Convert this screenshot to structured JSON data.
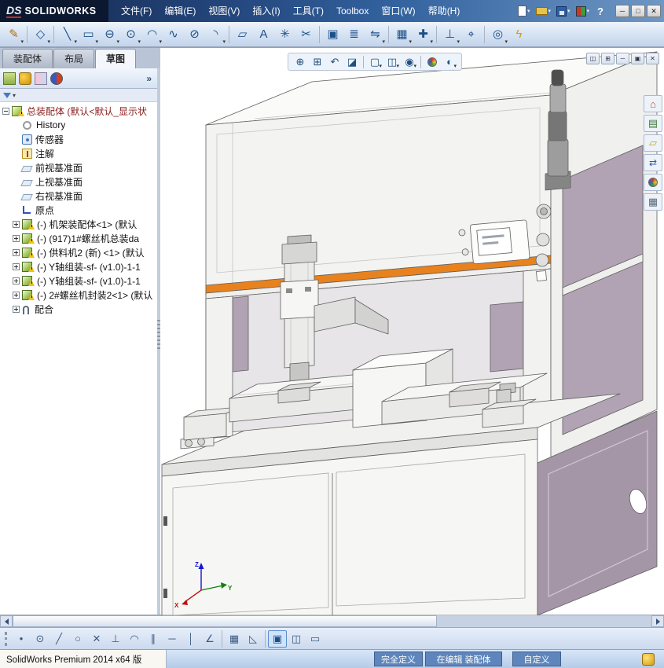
{
  "titlebar": {
    "logo_ds": "DS",
    "logo_name": "SOLIDWORKS",
    "menus": [
      "文件(F)",
      "编辑(E)",
      "视图(V)",
      "插入(I)",
      "工具(T)",
      "Toolbox",
      "窗口(W)",
      "帮助(H)"
    ],
    "help_glyph": "?",
    "window_buttons": [
      {
        "name": "minimize",
        "glyph": "─"
      },
      {
        "name": "restore",
        "glyph": "□"
      },
      {
        "name": "close",
        "glyph": "✕"
      }
    ]
  },
  "ui": {
    "caret": "▾",
    "chevrons": "»"
  },
  "sketch_toolbar": {
    "icons": [
      {
        "name": "exit-sketch",
        "glyph": "✎"
      },
      {
        "name": "smart-dimension",
        "glyph": "◇"
      },
      {
        "name": "line",
        "glyph": "╲"
      },
      {
        "name": "rectangle",
        "glyph": "▭"
      },
      {
        "name": "slot",
        "glyph": "⊖"
      },
      {
        "name": "circle",
        "glyph": "⊙"
      },
      {
        "name": "arc",
        "glyph": "◠"
      },
      {
        "name": "spline",
        "glyph": "∿"
      },
      {
        "name": "ellipse",
        "glyph": "⊘"
      },
      {
        "name": "fillet",
        "glyph": "◝"
      },
      {
        "name": "plane",
        "glyph": "▱"
      },
      {
        "name": "text",
        "glyph": "A"
      },
      {
        "name": "point",
        "glyph": "✳"
      },
      {
        "name": "trim",
        "glyph": "✂"
      },
      {
        "name": "convert-entities",
        "glyph": "▣"
      },
      {
        "name": "offset-entities",
        "glyph": "≣"
      },
      {
        "name": "mirror-entities",
        "glyph": "⇋"
      },
      {
        "name": "linear-pattern",
        "glyph": "▦"
      },
      {
        "name": "move-entities",
        "glyph": "✚"
      },
      {
        "name": "display-relations",
        "glyph": "⊥"
      },
      {
        "name": "repair-sketch",
        "glyph": "⌖"
      },
      {
        "name": "quick-snaps",
        "glyph": "◎"
      },
      {
        "name": "rapid-sketch",
        "glyph": "ϟ"
      }
    ]
  },
  "command_tabs": {
    "tabs": [
      "装配体",
      "布局",
      "草图"
    ],
    "active_index": 2
  },
  "feature_tree": {
    "items": [
      {
        "icon": "assembly",
        "label": "总装配体 (默认<默认_显示状",
        "warning": true
      },
      {
        "icon": "history",
        "label": "History"
      },
      {
        "icon": "sensors",
        "label": "传感器"
      },
      {
        "icon": "annotations",
        "label": "注解"
      },
      {
        "icon": "plane",
        "label": "前视基准面"
      },
      {
        "icon": "plane",
        "label": "上视基准面"
      },
      {
        "icon": "plane",
        "label": "右视基准面"
      },
      {
        "icon": "origin",
        "label": "原点"
      },
      {
        "icon": "component",
        "label": "(-) 机架装配体<1> (默认",
        "warning": true
      },
      {
        "icon": "component",
        "label": "(-) (917)1#螺丝机总装da",
        "warning": true
      },
      {
        "icon": "component",
        "label": "(-) 供料机2 (新) <1> (默认",
        "warning": true
      },
      {
        "icon": "component",
        "label": "(-) Y轴组装-sf- (v1.0)-1-1",
        "warning": true
      },
      {
        "icon": "component",
        "label": "(-) Y轴组装-sf- (v1.0)-1-1",
        "warning": true
      },
      {
        "icon": "component",
        "label": "(-) 2#螺丝机封装2<1> (默认",
        "warning": true
      },
      {
        "icon": "mates",
        "label": "配合"
      }
    ]
  },
  "viewport": {
    "headsup": [
      {
        "name": "zoom-to-fit",
        "glyph": "⊕"
      },
      {
        "name": "zoom-to-area",
        "glyph": "⊞"
      },
      {
        "name": "previous-view",
        "glyph": "↶"
      },
      {
        "name": "section-view",
        "glyph": "◪"
      },
      {
        "name": "view-orientation",
        "glyph": "▢"
      },
      {
        "name": "display-style",
        "glyph": "◫"
      },
      {
        "name": "hide-show-items",
        "glyph": "◉"
      },
      {
        "name": "edit-appearance",
        "glyph": "●"
      },
      {
        "name": "apply-scene",
        "glyph": "◐"
      }
    ],
    "doc_controls": [
      {
        "name": "viewport-layout",
        "glyph": "◫"
      },
      {
        "name": "pin-document",
        "glyph": "⊞"
      },
      {
        "name": "minimize-document",
        "glyph": "─"
      },
      {
        "name": "restore-document",
        "glyph": "▣"
      },
      {
        "name": "close-document",
        "glyph": "✕"
      }
    ],
    "triad": {
      "x": "X",
      "y": "Y",
      "z": "Z"
    }
  },
  "task_pane": {
    "icons": [
      {
        "name": "solidworks-resources",
        "glyph": "⌂"
      },
      {
        "name": "design-library",
        "glyph": "▤"
      },
      {
        "name": "file-explorer",
        "glyph": "▱"
      },
      {
        "name": "view-palette",
        "glyph": "⇄"
      },
      {
        "name": "appearances-scenes",
        "glyph": ""
      },
      {
        "name": "custom-properties",
        "glyph": "▦"
      }
    ]
  },
  "bottom_toolbar": {
    "icons": [
      {
        "name": "snap-points",
        "glyph": "•"
      },
      {
        "name": "snap-center",
        "glyph": "⊙"
      },
      {
        "name": "snap-line",
        "glyph": "╱"
      },
      {
        "name": "snap-circle",
        "glyph": "○"
      },
      {
        "name": "snap-intersection",
        "glyph": "✕"
      },
      {
        "name": "snap-perpendicular",
        "glyph": "⊥"
      },
      {
        "name": "snap-tangent",
        "glyph": "◠"
      },
      {
        "name": "snap-parallel",
        "glyph": "∥"
      },
      {
        "name": "snap-horizontal",
        "glyph": "─"
      },
      {
        "name": "snap-vertical",
        "glyph": "│"
      },
      {
        "name": "snap-angle",
        "glyph": "∠"
      },
      {
        "name": "grid-options",
        "glyph": "▦"
      },
      {
        "name": "snap-to-grid",
        "glyph": "◺"
      },
      {
        "name": "shaded-sketch-contours",
        "glyph": "▣"
      },
      {
        "name": "plane-display",
        "glyph": "◫"
      },
      {
        "name": "section-display",
        "glyph": "▭"
      }
    ]
  },
  "statusbar": {
    "product": "SolidWorks Premium 2014 x64 版",
    "fully_defined": "完全定义",
    "editing": "在编辑 装配体",
    "custom": "自定义"
  },
  "colors": {
    "mauve": "#b1a3b3",
    "mauve_dark": "#a596a7",
    "orange": "#e8821e",
    "status_blue": "#5e86bc",
    "title_blue": "#2d5a96"
  }
}
